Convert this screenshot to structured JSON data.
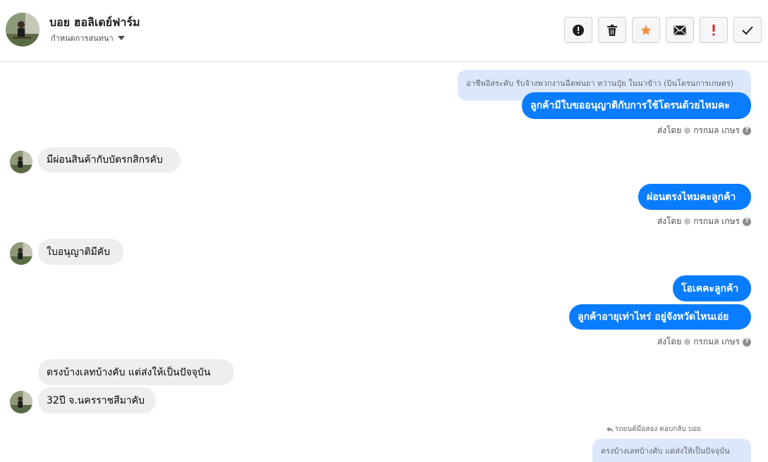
{
  "header": {
    "name": "บอย ฮอลิเดย์ฟาร์ม",
    "subtitle": "กำหนดการสนทนา",
    "actions": [
      {
        "name": "report-button",
        "icon": "exclamation-circle-icon"
      },
      {
        "name": "delete-button",
        "icon": "trash-icon"
      },
      {
        "name": "star-button",
        "icon": "star-icon"
      },
      {
        "name": "mail-button",
        "icon": "envelope-icon"
      },
      {
        "name": "mark-important-button",
        "icon": "exclamation-icon"
      },
      {
        "name": "mark-done-button",
        "icon": "checkmark-icon"
      }
    ]
  },
  "colors": {
    "outgoing_bubble": "#0a7cff",
    "incoming_bubble": "#eeeeee",
    "quoted_bubble": "#dbe8fc",
    "star": "#f5923e",
    "important": "#e02424"
  },
  "messages": {
    "quoted_1": "อาชีพอิสระคับ รับจ้างพวกงานฉีดพ่นยา หว่านปุ๋ย ในนาข้าว (บินโดรนการเกษตร)",
    "out_1": "ลูกค้ามีใบขออนุญาติกับการใช้โดรนด้วยไหมคะ",
    "in_1": "มีผ่อนสินค้ากับบัตรกสิกรคับ",
    "out_2": "ผ่อนตรงไหมคะลูกค้า",
    "in_2": "ใบอนุญาติมีคับ",
    "out_3": "โอเคคะลูกค้า",
    "out_4": "ลูกค้าอายุเท่าไหร่ อยู่จังหวัดไหนเอ่ย",
    "in_3": "ตรงบ้างเลทบ้างคับ แต่ส่งให้เป็นปัจจุบัน",
    "in_4": "32ปี จ.นครราชสีมาคับ",
    "reply_label": "รถยนต์มือสอง ตอบกลับ บอย",
    "reply_quoted": "ตรงบ้างเลทบ้างคับ แต่ส่งให้เป็นปัจจุบัน"
  },
  "sent_by": {
    "prefix": "ส่งโดย",
    "sender": "กรกมล เกษร",
    "help": "?"
  }
}
